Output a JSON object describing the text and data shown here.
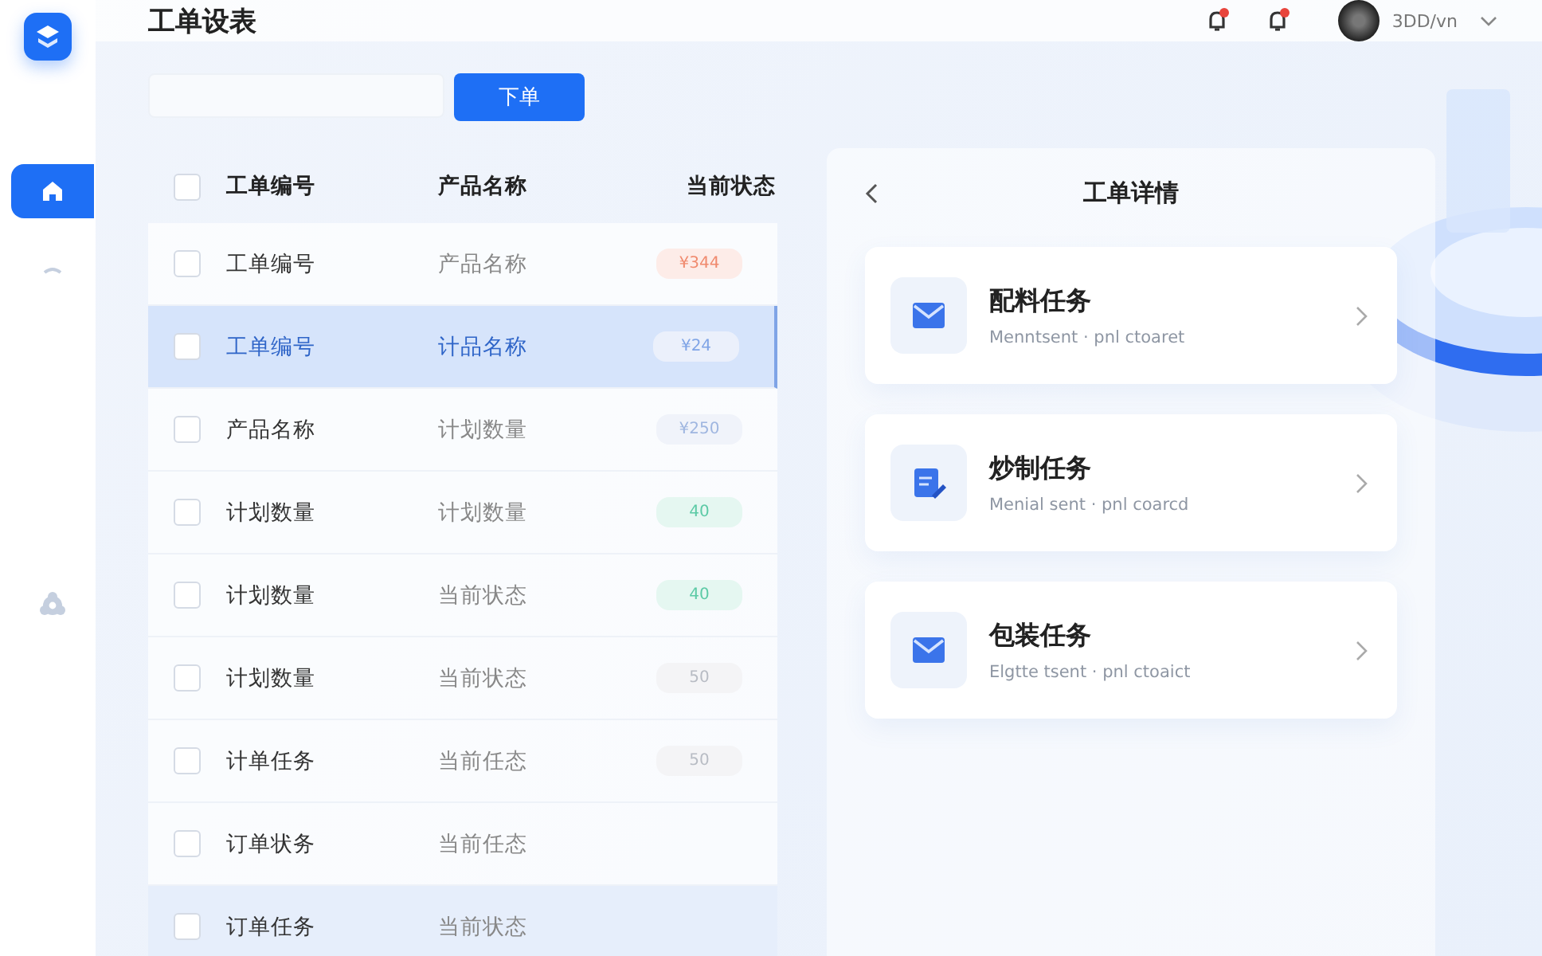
{
  "header": {
    "title": "工单设表",
    "user": {
      "name": "3DD/vn"
    },
    "notifications": [
      {
        "unread": true
      },
      {
        "unread": true
      }
    ]
  },
  "sidebar": {
    "items": [
      {
        "selected": true
      },
      {
        "selected": false
      },
      {
        "selected": false
      }
    ]
  },
  "toolbar": {
    "button": "下单"
  },
  "table": {
    "all_checked": false,
    "columns": [
      "工单编号",
      "产品名称",
      "当前状态"
    ],
    "rows": [
      {
        "col1": "工单编号",
        "col2": "产品名称",
        "status": "¥344",
        "color": "#f08a6e",
        "selected": false,
        "hovered": false
      },
      {
        "col1": "工单编号",
        "col2": "计品名称",
        "status": "¥24",
        "color": "#7fa4e6",
        "selected": true,
        "hovered": false
      },
      {
        "col1": "产品名称",
        "col2": "计划数量",
        "status": "¥250",
        "color": "#9fb6e0",
        "selected": false,
        "hovered": false
      },
      {
        "col1": "计划数量",
        "col2": "计划数量",
        "status": "40",
        "color": "#5ccaa6",
        "selected": false,
        "hovered": false
      },
      {
        "col1": "计划数量",
        "col2": "当前状态",
        "status": "40",
        "color": "#5ccaa6",
        "selected": false,
        "hovered": false
      },
      {
        "col1": "计划数量",
        "col2": "当前状态",
        "status": "50",
        "color": "#b8bcc4",
        "selected": false,
        "hovered": false
      },
      {
        "col1": "计单任务",
        "col2": "当前任态",
        "status": "50",
        "color": "#b8bcc4",
        "selected": false,
        "hovered": false
      },
      {
        "col1": "订单状务",
        "col2": "当前任态",
        "selected": false,
        "hovered": false
      },
      {
        "col1": "订单任务",
        "col2": "当前状态",
        "selected": false,
        "hovered": true
      }
    ]
  },
  "detail": {
    "title": "工单详情",
    "cards": [
      {
        "title": "配料任务",
        "subtitle": "Menntsent · pnl ctoaret"
      },
      {
        "title": "炒制任务",
        "subtitle": "Menial sent · pnl coarcd"
      },
      {
        "title": "包装任务",
        "subtitle": "Elgtte tsent · pnl ctoaict"
      }
    ]
  }
}
